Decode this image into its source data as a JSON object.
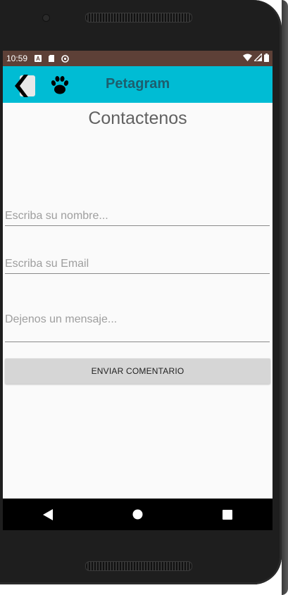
{
  "status_bar": {
    "time": "10:59",
    "icons": [
      "a-notification-icon",
      "sd-card-icon",
      "sync-icon"
    ],
    "right_icons": [
      "wifi-icon",
      "signal-icon",
      "battery-icon"
    ]
  },
  "app_bar": {
    "title": "Petagram",
    "color": "#00bcd4",
    "icons": [
      "back-icon",
      "paw-icon"
    ]
  },
  "page": {
    "title": "Contactenos"
  },
  "form": {
    "name_placeholder": "Escriba su nombre...",
    "email_placeholder": "Escriba su Email",
    "message_placeholder": "Dejenos un mensaje...",
    "name_value": "",
    "email_value": "",
    "message_value": ""
  },
  "actions": {
    "send_label": "ENVIAR COMENTARIO"
  },
  "nav_bar": {
    "icons": [
      "nav-back-icon",
      "nav-home-icon",
      "nav-recents-icon"
    ]
  }
}
